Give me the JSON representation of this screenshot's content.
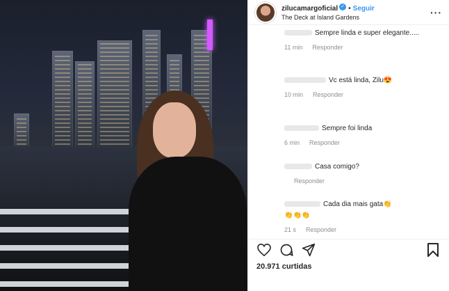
{
  "post": {
    "username": "zilucamargoficial",
    "verified_mark": "✓",
    "separator": "•",
    "follow_label": "Seguir",
    "location": "The Deck at Island Gardens",
    "more_label": "···"
  },
  "comments": [
    {
      "text": "Sempre linda e super elegante.....",
      "time": "11 min",
      "reply": "Responder"
    },
    {
      "text": "Vc está linda, Zilu😍",
      "time": "10 min",
      "reply": "Responder"
    },
    {
      "text": "Sempre foi linda",
      "time": "6 min",
      "reply": "Responder"
    },
    {
      "text": "Casa comigo?",
      "time": "",
      "reply": "Responder"
    },
    {
      "text": "Cada dia mais gata👏",
      "text2": "👏👏👏",
      "time": "21 s",
      "reply": "Responder"
    }
  ],
  "actions": {
    "icons": [
      "heart-icon",
      "comment-icon",
      "share-icon",
      "bookmark-icon"
    ]
  },
  "likes_text": "20.971 curtidas",
  "colors": {
    "accent": "#3897f0",
    "text": "#262626",
    "muted": "#8e8e8e"
  }
}
